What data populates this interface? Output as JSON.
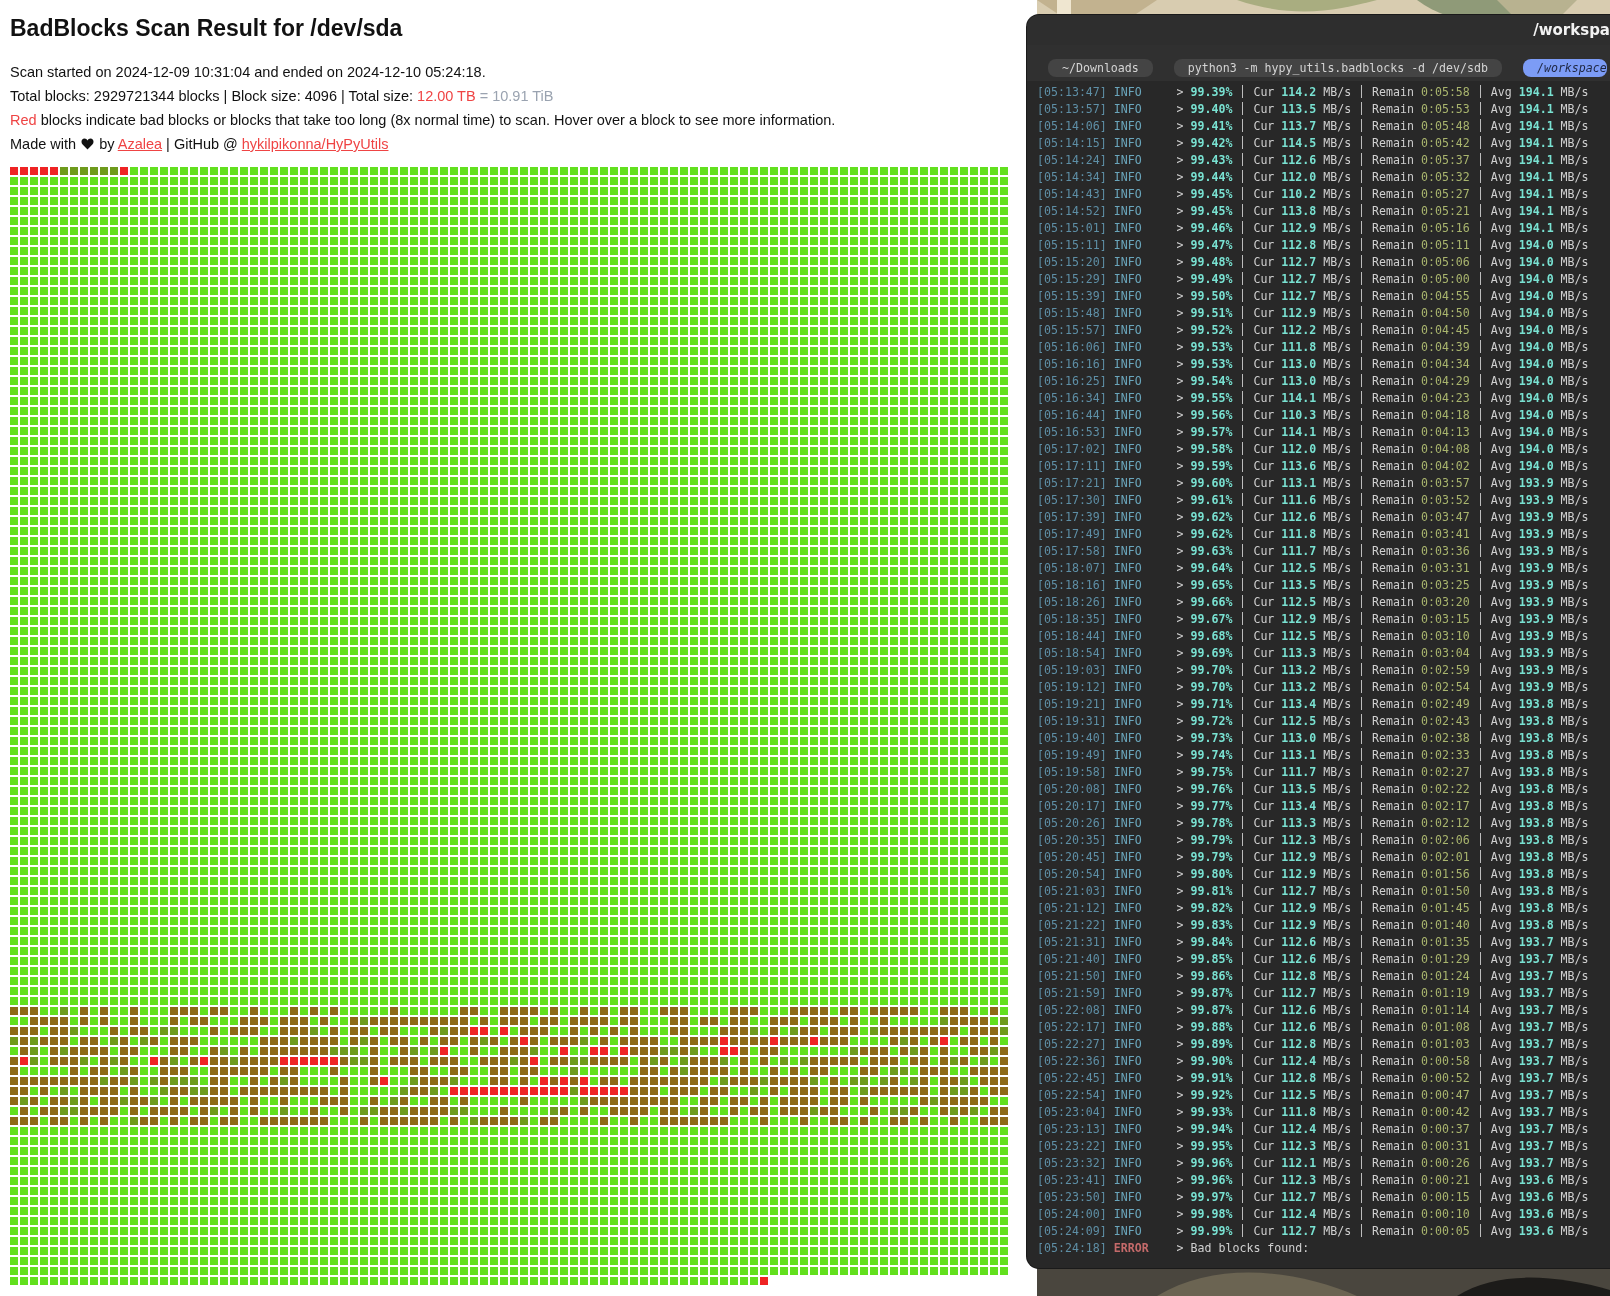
{
  "report": {
    "title": "BadBlocks Scan Result for /dev/sda",
    "scan_times": "Scan started on 2024-12-09 10:31:04 and ended on 2024-12-10 05:24:18.",
    "totals": {
      "text": "Total blocks: 2929721344 blocks | Block size: 4096 | Total size:",
      "size": "12.00 TB",
      "converted": "= 10.91 TiB"
    },
    "legend": {
      "highlight": "Red",
      "text": "blocks indicate bad blocks or blocks that take too long (8x normal time) to scan. Hover over a block to see more information."
    },
    "credit": {
      "before": "Made with",
      "by": "by",
      "author_link": "Azalea",
      "github": "| GitHub @",
      "repo_link": "hykilpikonna/HyPyUtils"
    }
  },
  "terminal": {
    "title": "/workspa",
    "tabs": [
      {
        "label": "~/Downloads",
        "selected": false
      },
      {
        "label": "python3 -m hypy_utils.badblocks -d /dev/sdb",
        "selected": false
      },
      {
        "label": "/workspace",
        "selected": true
      }
    ],
    "lines": [
      {
        "kind": "info",
        "time": "[05:13:47]",
        "level": "INFO",
        "prompt": ">",
        "percent": "99.39%",
        "cur_label": "Cur",
        "cur": "114.2",
        "cur_unit": "MB/s",
        "remain_label": "Remain",
        "remain": "0:05:58",
        "avg_label": "Avg",
        "avg": "194.1",
        "avg_unit": "MB/s"
      },
      {
        "kind": "info",
        "time": "[05:13:57]",
        "level": "INFO",
        "prompt": ">",
        "percent": "99.40%",
        "cur_label": "Cur",
        "cur": "113.5",
        "cur_unit": "MB/s",
        "remain_label": "Remain",
        "remain": "0:05:53",
        "avg_label": "Avg",
        "avg": "194.1",
        "avg_unit": "MB/s"
      },
      {
        "kind": "info",
        "time": "[05:14:06]",
        "level": "INFO",
        "prompt": ">",
        "percent": "99.41%",
        "cur_label": "Cur",
        "cur": "113.7",
        "cur_unit": "MB/s",
        "remain_label": "Remain",
        "remain": "0:05:48",
        "avg_label": "Avg",
        "avg": "194.1",
        "avg_unit": "MB/s"
      },
      {
        "kind": "info",
        "time": "[05:14:15]",
        "level": "INFO",
        "prompt": ">",
        "percent": "99.42%",
        "cur_label": "Cur",
        "cur": "114.5",
        "cur_unit": "MB/s",
        "remain_label": "Remain",
        "remain": "0:05:42",
        "avg_label": "Avg",
        "avg": "194.1",
        "avg_unit": "MB/s"
      },
      {
        "kind": "info",
        "time": "[05:14:24]",
        "level": "INFO",
        "prompt": ">",
        "percent": "99.43%",
        "cur_label": "Cur",
        "cur": "112.6",
        "cur_unit": "MB/s",
        "remain_label": "Remain",
        "remain": "0:05:37",
        "avg_label": "Avg",
        "avg": "194.1",
        "avg_unit": "MB/s"
      },
      {
        "kind": "info",
        "time": "[05:14:34]",
        "level": "INFO",
        "prompt": ">",
        "percent": "99.44%",
        "cur_label": "Cur",
        "cur": "112.0",
        "cur_unit": "MB/s",
        "remain_label": "Remain",
        "remain": "0:05:32",
        "avg_label": "Avg",
        "avg": "194.1",
        "avg_unit": "MB/s"
      },
      {
        "kind": "info",
        "time": "[05:14:43]",
        "level": "INFO",
        "prompt": ">",
        "percent": "99.45%",
        "cur_label": "Cur",
        "cur": "110.2",
        "cur_unit": "MB/s",
        "remain_label": "Remain",
        "remain": "0:05:27",
        "avg_label": "Avg",
        "avg": "194.1",
        "avg_unit": "MB/s"
      },
      {
        "kind": "info",
        "time": "[05:14:52]",
        "level": "INFO",
        "prompt": ">",
        "percent": "99.45%",
        "cur_label": "Cur",
        "cur": "113.8",
        "cur_unit": "MB/s",
        "remain_label": "Remain",
        "remain": "0:05:21",
        "avg_label": "Avg",
        "avg": "194.1",
        "avg_unit": "MB/s"
      },
      {
        "kind": "info",
        "time": "[05:15:01]",
        "level": "INFO",
        "prompt": ">",
        "percent": "99.46%",
        "cur_label": "Cur",
        "cur": "112.9",
        "cur_unit": "MB/s",
        "remain_label": "Remain",
        "remain": "0:05:16",
        "avg_label": "Avg",
        "avg": "194.1",
        "avg_unit": "MB/s"
      },
      {
        "kind": "info",
        "time": "[05:15:11]",
        "level": "INFO",
        "prompt": ">",
        "percent": "99.47%",
        "cur_label": "Cur",
        "cur": "112.8",
        "cur_unit": "MB/s",
        "remain_label": "Remain",
        "remain": "0:05:11",
        "avg_label": "Avg",
        "avg": "194.0",
        "avg_unit": "MB/s"
      },
      {
        "kind": "info",
        "time": "[05:15:20]",
        "level": "INFO",
        "prompt": ">",
        "percent": "99.48%",
        "cur_label": "Cur",
        "cur": "112.7",
        "cur_unit": "MB/s",
        "remain_label": "Remain",
        "remain": "0:05:06",
        "avg_label": "Avg",
        "avg": "194.0",
        "avg_unit": "MB/s"
      },
      {
        "kind": "info",
        "time": "[05:15:29]",
        "level": "INFO",
        "prompt": ">",
        "percent": "99.49%",
        "cur_label": "Cur",
        "cur": "112.7",
        "cur_unit": "MB/s",
        "remain_label": "Remain",
        "remain": "0:05:00",
        "avg_label": "Avg",
        "avg": "194.0",
        "avg_unit": "MB/s"
      },
      {
        "kind": "info",
        "time": "[05:15:39]",
        "level": "INFO",
        "prompt": ">",
        "percent": "99.50%",
        "cur_label": "Cur",
        "cur": "112.7",
        "cur_unit": "MB/s",
        "remain_label": "Remain",
        "remain": "0:04:55",
        "avg_label": "Avg",
        "avg": "194.0",
        "avg_unit": "MB/s"
      },
      {
        "kind": "info",
        "time": "[05:15:48]",
        "level": "INFO",
        "prompt": ">",
        "percent": "99.51%",
        "cur_label": "Cur",
        "cur": "112.9",
        "cur_unit": "MB/s",
        "remain_label": "Remain",
        "remain": "0:04:50",
        "avg_label": "Avg",
        "avg": "194.0",
        "avg_unit": "MB/s"
      },
      {
        "kind": "info",
        "time": "[05:15:57]",
        "level": "INFO",
        "prompt": ">",
        "percent": "99.52%",
        "cur_label": "Cur",
        "cur": "112.2",
        "cur_unit": "MB/s",
        "remain_label": "Remain",
        "remain": "0:04:45",
        "avg_label": "Avg",
        "avg": "194.0",
        "avg_unit": "MB/s"
      },
      {
        "kind": "info",
        "time": "[05:16:06]",
        "level": "INFO",
        "prompt": ">",
        "percent": "99.53%",
        "cur_label": "Cur",
        "cur": "111.8",
        "cur_unit": "MB/s",
        "remain_label": "Remain",
        "remain": "0:04:39",
        "avg_label": "Avg",
        "avg": "194.0",
        "avg_unit": "MB/s"
      },
      {
        "kind": "info",
        "time": "[05:16:16]",
        "level": "INFO",
        "prompt": ">",
        "percent": "99.53%",
        "cur_label": "Cur",
        "cur": "113.0",
        "cur_unit": "MB/s",
        "remain_label": "Remain",
        "remain": "0:04:34",
        "avg_label": "Avg",
        "avg": "194.0",
        "avg_unit": "MB/s"
      },
      {
        "kind": "info",
        "time": "[05:16:25]",
        "level": "INFO",
        "prompt": ">",
        "percent": "99.54%",
        "cur_label": "Cur",
        "cur": "113.0",
        "cur_unit": "MB/s",
        "remain_label": "Remain",
        "remain": "0:04:29",
        "avg_label": "Avg",
        "avg": "194.0",
        "avg_unit": "MB/s"
      },
      {
        "kind": "info",
        "time": "[05:16:34]",
        "level": "INFO",
        "prompt": ">",
        "percent": "99.55%",
        "cur_label": "Cur",
        "cur": "114.1",
        "cur_unit": "MB/s",
        "remain_label": "Remain",
        "remain": "0:04:23",
        "avg_label": "Avg",
        "avg": "194.0",
        "avg_unit": "MB/s"
      },
      {
        "kind": "info",
        "time": "[05:16:44]",
        "level": "INFO",
        "prompt": ">",
        "percent": "99.56%",
        "cur_label": "Cur",
        "cur": "110.3",
        "cur_unit": "MB/s",
        "remain_label": "Remain",
        "remain": "0:04:18",
        "avg_label": "Avg",
        "avg": "194.0",
        "avg_unit": "MB/s"
      },
      {
        "kind": "info",
        "time": "[05:16:53]",
        "level": "INFO",
        "prompt": ">",
        "percent": "99.57%",
        "cur_label": "Cur",
        "cur": "114.1",
        "cur_unit": "MB/s",
        "remain_label": "Remain",
        "remain": "0:04:13",
        "avg_label": "Avg",
        "avg": "194.0",
        "avg_unit": "MB/s"
      },
      {
        "kind": "info",
        "time": "[05:17:02]",
        "level": "INFO",
        "prompt": ">",
        "percent": "99.58%",
        "cur_label": "Cur",
        "cur": "112.0",
        "cur_unit": "MB/s",
        "remain_label": "Remain",
        "remain": "0:04:08",
        "avg_label": "Avg",
        "avg": "194.0",
        "avg_unit": "MB/s"
      },
      {
        "kind": "info",
        "time": "[05:17:11]",
        "level": "INFO",
        "prompt": ">",
        "percent": "99.59%",
        "cur_label": "Cur",
        "cur": "113.6",
        "cur_unit": "MB/s",
        "remain_label": "Remain",
        "remain": "0:04:02",
        "avg_label": "Avg",
        "avg": "194.0",
        "avg_unit": "MB/s"
      },
      {
        "kind": "info",
        "time": "[05:17:21]",
        "level": "INFO",
        "prompt": ">",
        "percent": "99.60%",
        "cur_label": "Cur",
        "cur": "113.1",
        "cur_unit": "MB/s",
        "remain_label": "Remain",
        "remain": "0:03:57",
        "avg_label": "Avg",
        "avg": "193.9",
        "avg_unit": "MB/s"
      },
      {
        "kind": "info",
        "time": "[05:17:30]",
        "level": "INFO",
        "prompt": ">",
        "percent": "99.61%",
        "cur_label": "Cur",
        "cur": "111.6",
        "cur_unit": "MB/s",
        "remain_label": "Remain",
        "remain": "0:03:52",
        "avg_label": "Avg",
        "avg": "193.9",
        "avg_unit": "MB/s"
      },
      {
        "kind": "info",
        "time": "[05:17:39]",
        "level": "INFO",
        "prompt": ">",
        "percent": "99.62%",
        "cur_label": "Cur",
        "cur": "112.6",
        "cur_unit": "MB/s",
        "remain_label": "Remain",
        "remain": "0:03:47",
        "avg_label": "Avg",
        "avg": "193.9",
        "avg_unit": "MB/s"
      },
      {
        "kind": "info",
        "time": "[05:17:49]",
        "level": "INFO",
        "prompt": ">",
        "percent": "99.62%",
        "cur_label": "Cur",
        "cur": "111.8",
        "cur_unit": "MB/s",
        "remain_label": "Remain",
        "remain": "0:03:41",
        "avg_label": "Avg",
        "avg": "193.9",
        "avg_unit": "MB/s"
      },
      {
        "kind": "info",
        "time": "[05:17:58]",
        "level": "INFO",
        "prompt": ">",
        "percent": "99.63%",
        "cur_label": "Cur",
        "cur": "111.7",
        "cur_unit": "MB/s",
        "remain_label": "Remain",
        "remain": "0:03:36",
        "avg_label": "Avg",
        "avg": "193.9",
        "avg_unit": "MB/s"
      },
      {
        "kind": "info",
        "time": "[05:18:07]",
        "level": "INFO",
        "prompt": ">",
        "percent": "99.64%",
        "cur_label": "Cur",
        "cur": "112.5",
        "cur_unit": "MB/s",
        "remain_label": "Remain",
        "remain": "0:03:31",
        "avg_label": "Avg",
        "avg": "193.9",
        "avg_unit": "MB/s"
      },
      {
        "kind": "info",
        "time": "[05:18:16]",
        "level": "INFO",
        "prompt": ">",
        "percent": "99.65%",
        "cur_label": "Cur",
        "cur": "113.5",
        "cur_unit": "MB/s",
        "remain_label": "Remain",
        "remain": "0:03:25",
        "avg_label": "Avg",
        "avg": "193.9",
        "avg_unit": "MB/s"
      },
      {
        "kind": "info",
        "time": "[05:18:26]",
        "level": "INFO",
        "prompt": ">",
        "percent": "99.66%",
        "cur_label": "Cur",
        "cur": "112.5",
        "cur_unit": "MB/s",
        "remain_label": "Remain",
        "remain": "0:03:20",
        "avg_label": "Avg",
        "avg": "193.9",
        "avg_unit": "MB/s"
      },
      {
        "kind": "info",
        "time": "[05:18:35]",
        "level": "INFO",
        "prompt": ">",
        "percent": "99.67%",
        "cur_label": "Cur",
        "cur": "112.9",
        "cur_unit": "MB/s",
        "remain_label": "Remain",
        "remain": "0:03:15",
        "avg_label": "Avg",
        "avg": "193.9",
        "avg_unit": "MB/s"
      },
      {
        "kind": "info",
        "time": "[05:18:44]",
        "level": "INFO",
        "prompt": ">",
        "percent": "99.68%",
        "cur_label": "Cur",
        "cur": "112.5",
        "cur_unit": "MB/s",
        "remain_label": "Remain",
        "remain": "0:03:10",
        "avg_label": "Avg",
        "avg": "193.9",
        "avg_unit": "MB/s"
      },
      {
        "kind": "info",
        "time": "[05:18:54]",
        "level": "INFO",
        "prompt": ">",
        "percent": "99.69%",
        "cur_label": "Cur",
        "cur": "113.3",
        "cur_unit": "MB/s",
        "remain_label": "Remain",
        "remain": "0:03:04",
        "avg_label": "Avg",
        "avg": "193.9",
        "avg_unit": "MB/s"
      },
      {
        "kind": "info",
        "time": "[05:19:03]",
        "level": "INFO",
        "prompt": ">",
        "percent": "99.70%",
        "cur_label": "Cur",
        "cur": "113.2",
        "cur_unit": "MB/s",
        "remain_label": "Remain",
        "remain": "0:02:59",
        "avg_label": "Avg",
        "avg": "193.9",
        "avg_unit": "MB/s"
      },
      {
        "kind": "info",
        "time": "[05:19:12]",
        "level": "INFO",
        "prompt": ">",
        "percent": "99.70%",
        "cur_label": "Cur",
        "cur": "113.2",
        "cur_unit": "MB/s",
        "remain_label": "Remain",
        "remain": "0:02:54",
        "avg_label": "Avg",
        "avg": "193.9",
        "avg_unit": "MB/s"
      },
      {
        "kind": "info",
        "time": "[05:19:21]",
        "level": "INFO",
        "prompt": ">",
        "percent": "99.71%",
        "cur_label": "Cur",
        "cur": "113.4",
        "cur_unit": "MB/s",
        "remain_label": "Remain",
        "remain": "0:02:49",
        "avg_label": "Avg",
        "avg": "193.8",
        "avg_unit": "MB/s"
      },
      {
        "kind": "info",
        "time": "[05:19:31]",
        "level": "INFO",
        "prompt": ">",
        "percent": "99.72%",
        "cur_label": "Cur",
        "cur": "112.5",
        "cur_unit": "MB/s",
        "remain_label": "Remain",
        "remain": "0:02:43",
        "avg_label": "Avg",
        "avg": "193.8",
        "avg_unit": "MB/s"
      },
      {
        "kind": "info",
        "time": "[05:19:40]",
        "level": "INFO",
        "prompt": ">",
        "percent": "99.73%",
        "cur_label": "Cur",
        "cur": "113.0",
        "cur_unit": "MB/s",
        "remain_label": "Remain",
        "remain": "0:02:38",
        "avg_label": "Avg",
        "avg": "193.8",
        "avg_unit": "MB/s"
      },
      {
        "kind": "info",
        "time": "[05:19:49]",
        "level": "INFO",
        "prompt": ">",
        "percent": "99.74%",
        "cur_label": "Cur",
        "cur": "113.1",
        "cur_unit": "MB/s",
        "remain_label": "Remain",
        "remain": "0:02:33",
        "avg_label": "Avg",
        "avg": "193.8",
        "avg_unit": "MB/s"
      },
      {
        "kind": "info",
        "time": "[05:19:58]",
        "level": "INFO",
        "prompt": ">",
        "percent": "99.75%",
        "cur_label": "Cur",
        "cur": "111.7",
        "cur_unit": "MB/s",
        "remain_label": "Remain",
        "remain": "0:02:27",
        "avg_label": "Avg",
        "avg": "193.8",
        "avg_unit": "MB/s"
      },
      {
        "kind": "info",
        "time": "[05:20:08]",
        "level": "INFO",
        "prompt": ">",
        "percent": "99.76%",
        "cur_label": "Cur",
        "cur": "113.5",
        "cur_unit": "MB/s",
        "remain_label": "Remain",
        "remain": "0:02:22",
        "avg_label": "Avg",
        "avg": "193.8",
        "avg_unit": "MB/s"
      },
      {
        "kind": "info",
        "time": "[05:20:17]",
        "level": "INFO",
        "prompt": ">",
        "percent": "99.77%",
        "cur_label": "Cur",
        "cur": "113.4",
        "cur_unit": "MB/s",
        "remain_label": "Remain",
        "remain": "0:02:17",
        "avg_label": "Avg",
        "avg": "193.8",
        "avg_unit": "MB/s"
      },
      {
        "kind": "info",
        "time": "[05:20:26]",
        "level": "INFO",
        "prompt": ">",
        "percent": "99.78%",
        "cur_label": "Cur",
        "cur": "113.3",
        "cur_unit": "MB/s",
        "remain_label": "Remain",
        "remain": "0:02:12",
        "avg_label": "Avg",
        "avg": "193.8",
        "avg_unit": "MB/s"
      },
      {
        "kind": "info",
        "time": "[05:20:35]",
        "level": "INFO",
        "prompt": ">",
        "percent": "99.79%",
        "cur_label": "Cur",
        "cur": "112.3",
        "cur_unit": "MB/s",
        "remain_label": "Remain",
        "remain": "0:02:06",
        "avg_label": "Avg",
        "avg": "193.8",
        "avg_unit": "MB/s"
      },
      {
        "kind": "info",
        "time": "[05:20:45]",
        "level": "INFO",
        "prompt": ">",
        "percent": "99.79%",
        "cur_label": "Cur",
        "cur": "112.9",
        "cur_unit": "MB/s",
        "remain_label": "Remain",
        "remain": "0:02:01",
        "avg_label": "Avg",
        "avg": "193.8",
        "avg_unit": "MB/s"
      },
      {
        "kind": "info",
        "time": "[05:20:54]",
        "level": "INFO",
        "prompt": ">",
        "percent": "99.80%",
        "cur_label": "Cur",
        "cur": "112.9",
        "cur_unit": "MB/s",
        "remain_label": "Remain",
        "remain": "0:01:56",
        "avg_label": "Avg",
        "avg": "193.8",
        "avg_unit": "MB/s"
      },
      {
        "kind": "info",
        "time": "[05:21:03]",
        "level": "INFO",
        "prompt": ">",
        "percent": "99.81%",
        "cur_label": "Cur",
        "cur": "112.7",
        "cur_unit": "MB/s",
        "remain_label": "Remain",
        "remain": "0:01:50",
        "avg_label": "Avg",
        "avg": "193.8",
        "avg_unit": "MB/s"
      },
      {
        "kind": "info",
        "time": "[05:21:12]",
        "level": "INFO",
        "prompt": ">",
        "percent": "99.82%",
        "cur_label": "Cur",
        "cur": "112.9",
        "cur_unit": "MB/s",
        "remain_label": "Remain",
        "remain": "0:01:45",
        "avg_label": "Avg",
        "avg": "193.8",
        "avg_unit": "MB/s"
      },
      {
        "kind": "info",
        "time": "[05:21:22]",
        "level": "INFO",
        "prompt": ">",
        "percent": "99.83%",
        "cur_label": "Cur",
        "cur": "112.9",
        "cur_unit": "MB/s",
        "remain_label": "Remain",
        "remain": "0:01:40",
        "avg_label": "Avg",
        "avg": "193.8",
        "avg_unit": "MB/s"
      },
      {
        "kind": "info",
        "time": "[05:21:31]",
        "level": "INFO",
        "prompt": ">",
        "percent": "99.84%",
        "cur_label": "Cur",
        "cur": "112.6",
        "cur_unit": "MB/s",
        "remain_label": "Remain",
        "remain": "0:01:35",
        "avg_label": "Avg",
        "avg": "193.7",
        "avg_unit": "MB/s"
      },
      {
        "kind": "info",
        "time": "[05:21:40]",
        "level": "INFO",
        "prompt": ">",
        "percent": "99.85%",
        "cur_label": "Cur",
        "cur": "112.6",
        "cur_unit": "MB/s",
        "remain_label": "Remain",
        "remain": "0:01:29",
        "avg_label": "Avg",
        "avg": "193.7",
        "avg_unit": "MB/s"
      },
      {
        "kind": "info",
        "time": "[05:21:50]",
        "level": "INFO",
        "prompt": ">",
        "percent": "99.86%",
        "cur_label": "Cur",
        "cur": "112.8",
        "cur_unit": "MB/s",
        "remain_label": "Remain",
        "remain": "0:01:24",
        "avg_label": "Avg",
        "avg": "193.7",
        "avg_unit": "MB/s"
      },
      {
        "kind": "info",
        "time": "[05:21:59]",
        "level": "INFO",
        "prompt": ">",
        "percent": "99.87%",
        "cur_label": "Cur",
        "cur": "112.7",
        "cur_unit": "MB/s",
        "remain_label": "Remain",
        "remain": "0:01:19",
        "avg_label": "Avg",
        "avg": "193.7",
        "avg_unit": "MB/s"
      },
      {
        "kind": "info",
        "time": "[05:22:08]",
        "level": "INFO",
        "prompt": ">",
        "percent": "99.87%",
        "cur_label": "Cur",
        "cur": "112.6",
        "cur_unit": "MB/s",
        "remain_label": "Remain",
        "remain": "0:01:14",
        "avg_label": "Avg",
        "avg": "193.7",
        "avg_unit": "MB/s"
      },
      {
        "kind": "info",
        "time": "[05:22:17]",
        "level": "INFO",
        "prompt": ">",
        "percent": "99.88%",
        "cur_label": "Cur",
        "cur": "112.6",
        "cur_unit": "MB/s",
        "remain_label": "Remain",
        "remain": "0:01:08",
        "avg_label": "Avg",
        "avg": "193.7",
        "avg_unit": "MB/s"
      },
      {
        "kind": "info",
        "time": "[05:22:27]",
        "level": "INFO",
        "prompt": ">",
        "percent": "99.89%",
        "cur_label": "Cur",
        "cur": "112.8",
        "cur_unit": "MB/s",
        "remain_label": "Remain",
        "remain": "0:01:03",
        "avg_label": "Avg",
        "avg": "193.7",
        "avg_unit": "MB/s"
      },
      {
        "kind": "info",
        "time": "[05:22:36]",
        "level": "INFO",
        "prompt": ">",
        "percent": "99.90%",
        "cur_label": "Cur",
        "cur": "112.4",
        "cur_unit": "MB/s",
        "remain_label": "Remain",
        "remain": "0:00:58",
        "avg_label": "Avg",
        "avg": "193.7",
        "avg_unit": "MB/s"
      },
      {
        "kind": "info",
        "time": "[05:22:45]",
        "level": "INFO",
        "prompt": ">",
        "percent": "99.91%",
        "cur_label": "Cur",
        "cur": "112.8",
        "cur_unit": "MB/s",
        "remain_label": "Remain",
        "remain": "0:00:52",
        "avg_label": "Avg",
        "avg": "193.7",
        "avg_unit": "MB/s"
      },
      {
        "kind": "info",
        "time": "[05:22:54]",
        "level": "INFO",
        "prompt": ">",
        "percent": "99.92%",
        "cur_label": "Cur",
        "cur": "112.5",
        "cur_unit": "MB/s",
        "remain_label": "Remain",
        "remain": "0:00:47",
        "avg_label": "Avg",
        "avg": "193.7",
        "avg_unit": "MB/s"
      },
      {
        "kind": "info",
        "time": "[05:23:04]",
        "level": "INFO",
        "prompt": ">",
        "percent": "99.93%",
        "cur_label": "Cur",
        "cur": "111.8",
        "cur_unit": "MB/s",
        "remain_label": "Remain",
        "remain": "0:00:42",
        "avg_label": "Avg",
        "avg": "193.7",
        "avg_unit": "MB/s"
      },
      {
        "kind": "info",
        "time": "[05:23:13]",
        "level": "INFO",
        "prompt": ">",
        "percent": "99.94%",
        "cur_label": "Cur",
        "cur": "112.4",
        "cur_unit": "MB/s",
        "remain_label": "Remain",
        "remain": "0:00:37",
        "avg_label": "Avg",
        "avg": "193.7",
        "avg_unit": "MB/s"
      },
      {
        "kind": "info",
        "time": "[05:23:22]",
        "level": "INFO",
        "prompt": ">",
        "percent": "99.95%",
        "cur_label": "Cur",
        "cur": "112.3",
        "cur_unit": "MB/s",
        "remain_label": "Remain",
        "remain": "0:00:31",
        "avg_label": "Avg",
        "avg": "193.7",
        "avg_unit": "MB/s"
      },
      {
        "kind": "info",
        "time": "[05:23:32]",
        "level": "INFO",
        "prompt": ">",
        "percent": "99.96%",
        "cur_label": "Cur",
        "cur": "112.1",
        "cur_unit": "MB/s",
        "remain_label": "Remain",
        "remain": "0:00:26",
        "avg_label": "Avg",
        "avg": "193.7",
        "avg_unit": "MB/s"
      },
      {
        "kind": "info",
        "time": "[05:23:41]",
        "level": "INFO",
        "prompt": ">",
        "percent": "99.96%",
        "cur_label": "Cur",
        "cur": "112.3",
        "cur_unit": "MB/s",
        "remain_label": "Remain",
        "remain": "0:00:21",
        "avg_label": "Avg",
        "avg": "193.6",
        "avg_unit": "MB/s"
      },
      {
        "kind": "info",
        "time": "[05:23:50]",
        "level": "INFO",
        "prompt": ">",
        "percent": "99.97%",
        "cur_label": "Cur",
        "cur": "112.7",
        "cur_unit": "MB/s",
        "remain_label": "Remain",
        "remain": "0:00:15",
        "avg_label": "Avg",
        "avg": "193.6",
        "avg_unit": "MB/s"
      },
      {
        "kind": "info",
        "time": "[05:24:00]",
        "level": "INFO",
        "prompt": ">",
        "percent": "99.98%",
        "cur_label": "Cur",
        "cur": "112.4",
        "cur_unit": "MB/s",
        "remain_label": "Remain",
        "remain": "0:00:10",
        "avg_label": "Avg",
        "avg": "193.6",
        "avg_unit": "MB/s"
      },
      {
        "kind": "info",
        "time": "[05:24:09]",
        "level": "INFO",
        "prompt": ">",
        "percent": "99.99%",
        "cur_label": "Cur",
        "cur": "112.7",
        "cur_unit": "MB/s",
        "remain_label": "Remain",
        "remain": "0:00:05",
        "avg_label": "Avg",
        "avg": "193.6",
        "avg_unit": "MB/s"
      },
      {
        "kind": "error",
        "time": "[05:24:18]",
        "level": "ERROR",
        "prompt": ">",
        "message": "Bad blocks found:"
      }
    ]
  }
}
